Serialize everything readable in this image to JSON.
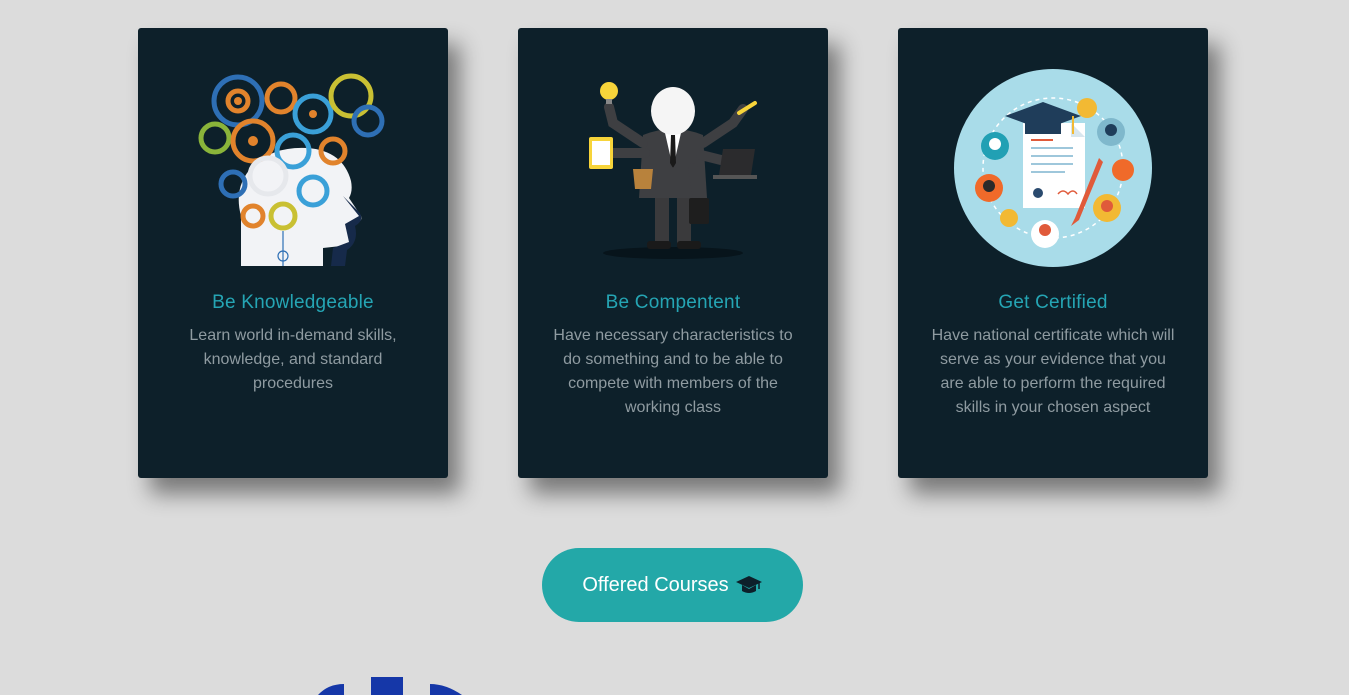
{
  "cards": [
    {
      "title": "Be Knowledgeable",
      "description": "Learn world in-demand skills, knowledge, and standard procedures",
      "image": "gears-head-illustration"
    },
    {
      "title": "Be Compentent",
      "description": "Have necessary characteristics to do something and to be able to compete with members of the working class",
      "image": "multitasking-businessman-illustration"
    },
    {
      "title": "Get Certified",
      "description": "Have national certificate which will serve as your evidence that you are able to perform the required skills in your chosen aspect",
      "image": "certificate-circle-illustration"
    }
  ],
  "cta": {
    "label": "Offered Courses",
    "icon": "graduation-cap-icon"
  },
  "colors": {
    "background": "#dcdcdc",
    "card": "#0d202a",
    "title": "#25a5b4",
    "text": "#8f9ba1",
    "button": "#23a8a8",
    "logo": "#1537a8"
  }
}
